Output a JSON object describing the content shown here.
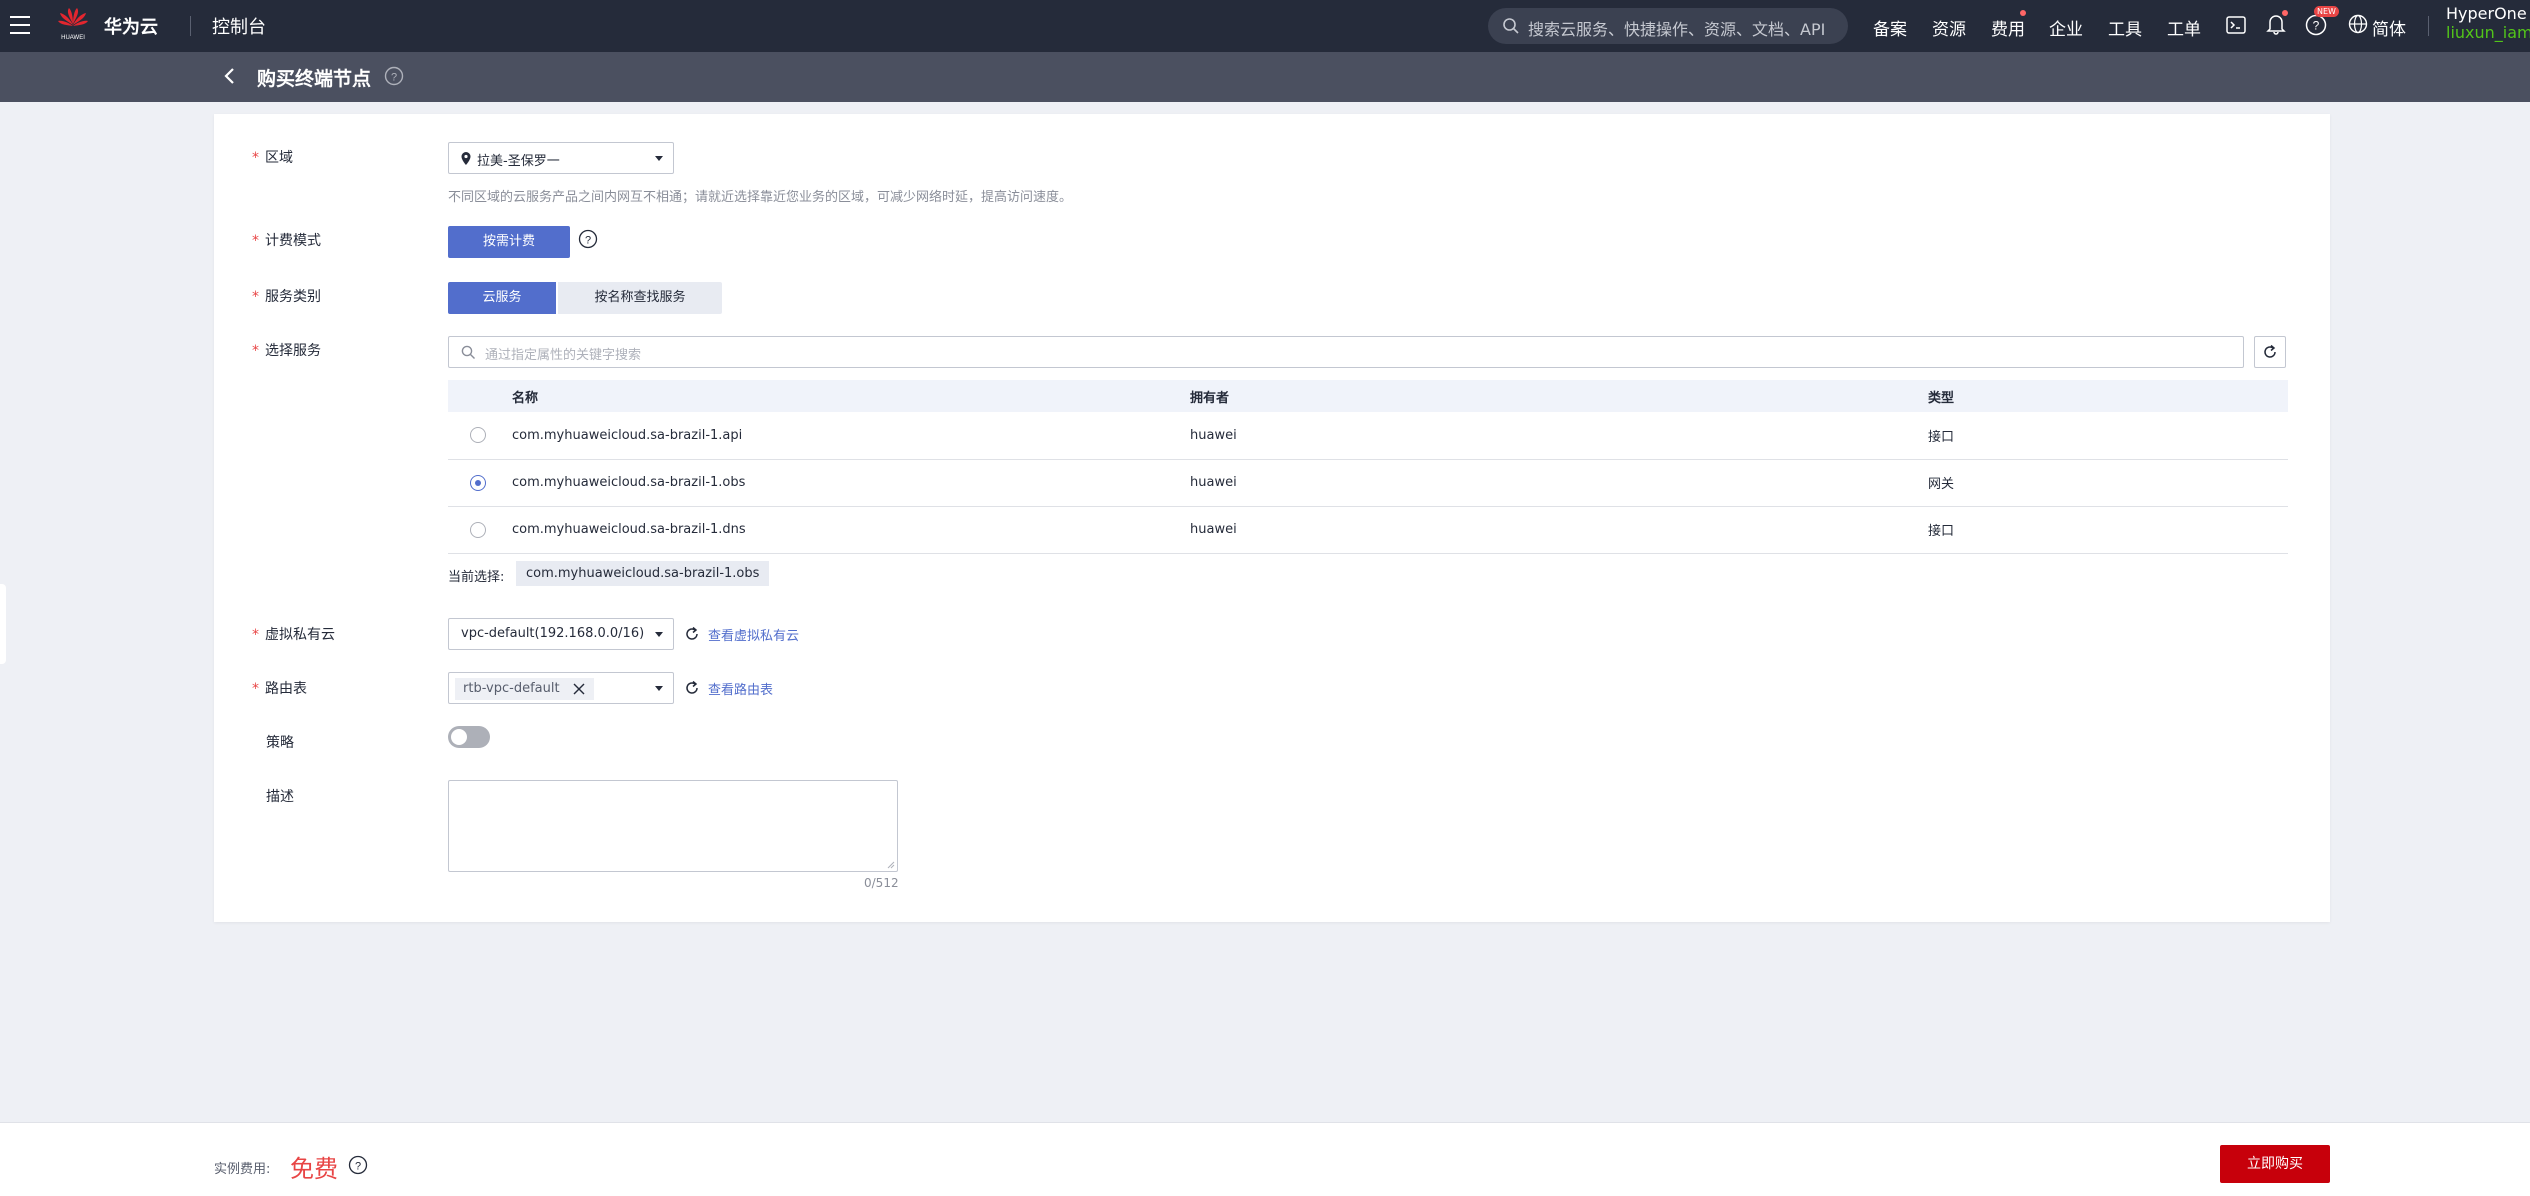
{
  "topbar": {
    "brand": "华为云",
    "logo_text": "HUAWEI",
    "console": "控制台",
    "search_placeholder": "搜索云服务、快捷操作、资源、文档、API",
    "links": [
      "备案",
      "资源",
      "费用",
      "企业",
      "工具",
      "工单"
    ],
    "new_badge": "NEW",
    "language": "简体",
    "account": "HyperOne",
    "user": "liuxun_iam"
  },
  "page": {
    "title": "购买终端节点"
  },
  "form": {
    "region": {
      "label": "区域",
      "value": "拉美-圣保罗一",
      "hint": "不同区域的云服务产品之间内网互不相通；请就近选择靠近您业务的区域，可减少网络时延，提高访问速度。"
    },
    "billing": {
      "label": "计费模式",
      "option": "按需计费"
    },
    "service_type": {
      "label": "服务类别",
      "options": [
        "云服务",
        "按名称查找服务"
      ],
      "selected": "云服务"
    },
    "service_select": {
      "label": "选择服务",
      "search_placeholder": "通过指定属性的关键字搜索",
      "columns": [
        "名称",
        "拥有者",
        "类型"
      ],
      "rows": [
        {
          "name": "com.myhuaweicloud.sa-brazil-1.api",
          "owner": "huawei",
          "type": "接口",
          "selected": false
        },
        {
          "name": "com.myhuaweicloud.sa-brazil-1.obs",
          "owner": "huawei",
          "type": "网关",
          "selected": true
        },
        {
          "name": "com.myhuaweicloud.sa-brazil-1.dns",
          "owner": "huawei",
          "type": "接口",
          "selected": false
        }
      ],
      "current_label": "当前选择:",
      "current_value": "com.myhuaweicloud.sa-brazil-1.obs"
    },
    "vpc": {
      "label": "虚拟私有云",
      "value": "vpc-default(192.168.0.0/16)",
      "link": "查看虚拟私有云"
    },
    "route_table": {
      "label": "路由表",
      "tag": "rtb-vpc-default",
      "link": "查看路由表"
    },
    "policy": {
      "label": "策略",
      "enabled": false
    },
    "description": {
      "label": "描述",
      "value": "",
      "counter": "0/512"
    }
  },
  "footer": {
    "fee_label": "实例费用:",
    "fee_value": "免费",
    "buy_button": "立即购买"
  },
  "colors": {
    "topbar_bg": "#252b3a",
    "subbar_bg": "#4b5060",
    "primary": "#526ecc",
    "danger": "#c7000b",
    "price": "#e84545"
  }
}
